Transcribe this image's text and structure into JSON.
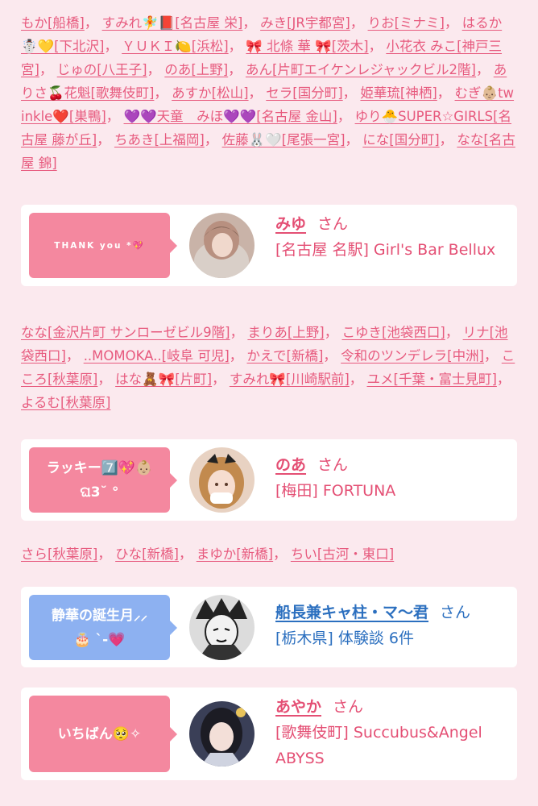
{
  "list1": [
    "もか[船橋]",
    "すみれ🧚📕[名古屋 栄]",
    "みき[JR宇都宮]",
    "りお[ミナミ]",
    "はるか☃️💛[下北沢]",
    "ＹＵＫＩ🍋[浜松]",
    "🎀 北條 華 🎀[茨木]",
    "小花衣 みこ[神戸三宮]",
    "じゅの[八王子]",
    "のあ[上野]",
    "あん[片町エイケンレジャックビル2階]",
    "ありさ🍒花魁[歌舞伎町]",
    "あすか[松山]",
    "セラ[国分町]",
    "姫華琉[神栖]",
    "むぎ👶🏼twinkle❤️[巣鴨]",
    "💜💜天童　みほ💜💜[名古屋 金山]",
    "ゆり🐣SUPER☆GIRLS[名古屋 藤が丘]",
    "ちあき[上福岡]",
    "佐藤🐰🤍[尾張一宮]",
    "にな[国分町]",
    "なな[名古屋 錦]"
  ],
  "list2": [
    "なな[金沢片町 サンローゼビル9階]",
    "まりあ[上野]",
    "こゆき[池袋西口]",
    "リナ[池袋西口]",
    "..MOMOKA..[岐阜 可児]",
    "かえで[新橋]",
    "令和のツンデレラ[中洲]",
    "こころ[秋葉原]",
    "はな🧸🎀[片町]",
    "すみれ🎀[川崎駅前]",
    "ユメ[千葉・富士見町]",
    "よるむ[秋葉原]"
  ],
  "list3": [
    "さら[秋葉原]",
    "ひな[新橋]",
    "まゆか[新橋]",
    "ちい[古河・東口]"
  ],
  "cards": [
    {
      "message": "THANK you *💖",
      "name": "みゆ",
      "san": "さん",
      "detail": "[名古屋 名駅] Girl's Bar Bellux"
    },
    {
      "message": "ラッキー7️⃣💖👶🏼\nଘ3˘ °",
      "name": "のあ",
      "san": "さん",
      "detail": "[梅田] FORTUNA"
    },
    {
      "message": "静華の誕生月⸝⸝\n🎂 ˋ-💗",
      "name": "船長兼キャ柱・マ〜君",
      "san": "さん",
      "detail": "[栃木県] 体験談 6件"
    },
    {
      "message": "いちばん🥺✧",
      "name": "あやか",
      "san": "さん",
      "detail": "[歌舞伎町] Succubus&Angel ABYSS"
    }
  ],
  "colors": {
    "background": "#fbe9ee",
    "link_pink": "#e75a7e",
    "bubble_pink": "#f4889f",
    "bubble_blue": "#8db1f1",
    "name_blue": "#2b6fbf"
  },
  "avatar_icons": [
    "user-photo-icon",
    "user-photo-icon",
    "manga-character-icon",
    "user-photo-icon"
  ]
}
